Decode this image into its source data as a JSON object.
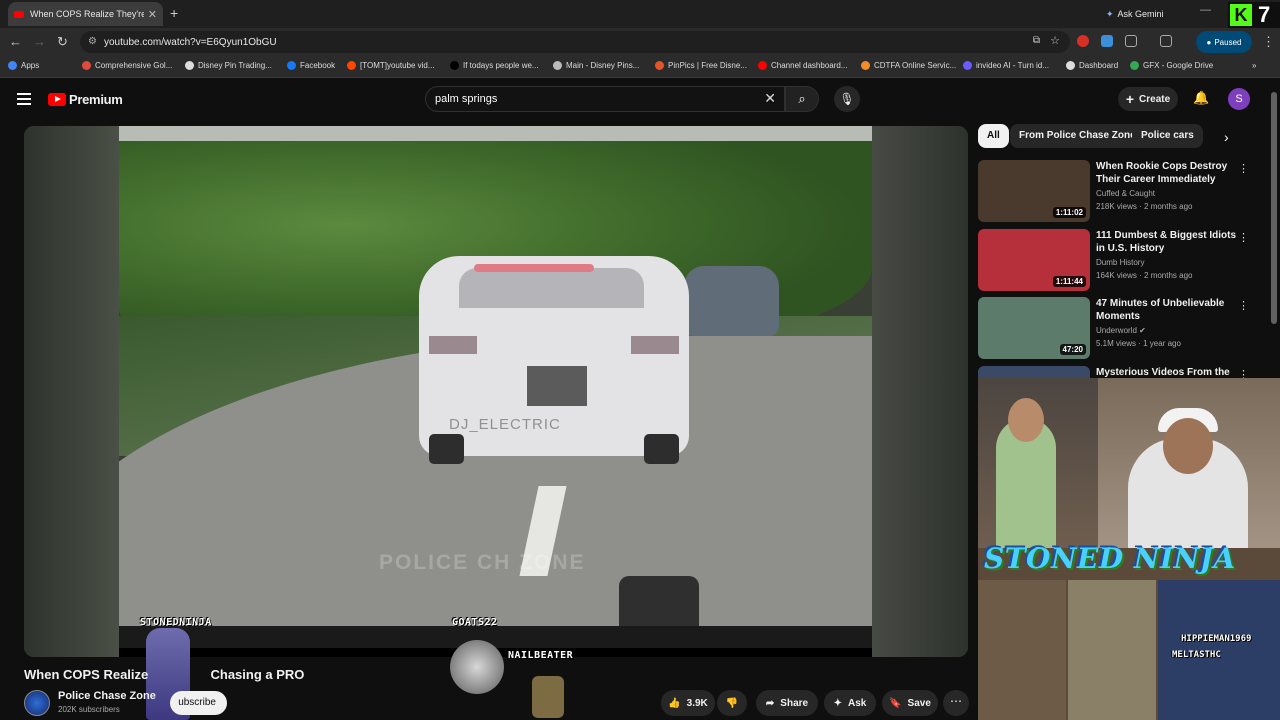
{
  "browser": {
    "tab_title": "When COPS Realize They're Ch",
    "new_tab": "+",
    "ask_gemini": "Ask Gemini",
    "kick_badge": "7",
    "url": "youtube.com/watch?v=E6Qyun1ObGU",
    "paused_label": "Paused",
    "bookmarks": [
      {
        "label": "Apps",
        "color": "#4285f4"
      },
      {
        "label": "Comprehensive Gol...",
        "color": "#e04a3a"
      },
      {
        "label": "Disney Pin Trading...",
        "color": "#dddddd"
      },
      {
        "label": "Facebook",
        "color": "#1877f2"
      },
      {
        "label": "[TOMT]youtube vid...",
        "color": "#ff4500"
      },
      {
        "label": "If todays people we...",
        "color": "#000000"
      },
      {
        "label": "Main - Disney Pins...",
        "color": "#bbbbbb"
      },
      {
        "label": "PinPics | Free Disne...",
        "color": "#e2542a"
      },
      {
        "label": "Channel dashboard...",
        "color": "#ff0000"
      },
      {
        "label": "CDTFA Online Servic...",
        "color": "#f28c28"
      },
      {
        "label": "invideo AI - Turn id...",
        "color": "#6a5cff"
      },
      {
        "label": "Dashboard",
        "color": "#dddddd"
      },
      {
        "label": "GFX - Google Drive",
        "color": "#34a853"
      }
    ]
  },
  "youtube": {
    "logo_text": "Premium",
    "search_value": "palm springs",
    "create_label": "Create",
    "avatar_letter": "S"
  },
  "video": {
    "title_left": "When COPS Realize",
    "title_right": "Chasing a PRO",
    "channel": "Police Chase Zone",
    "subscribers": "202K subscribers",
    "subscribe_label": "ubscribe",
    "likes": "3.9K",
    "share_label": "Share",
    "ask_label": "Ask",
    "save_label": "Save",
    "watermark": "POLICE CH      ZONE",
    "plate_text": "DJ_ELECTRIC"
  },
  "overlays": {
    "stoned_small": "STONEDNINJA",
    "goats": "GOATS22",
    "nailbeater": "NAILBEATER",
    "stoned_big": "STONED NINJA",
    "hippie": "HIPPIEMAN1969",
    "melt": "MELTASTHC"
  },
  "sidebar": {
    "chips": [
      "All",
      "From Police Chase Zone",
      "Police cars"
    ],
    "recs": [
      {
        "title": "When Rookie Cops Destroy Their Career Immediately",
        "channel": "Cuffed & Caught",
        "meta": "218K views · 2 months ago",
        "duration": "1:11:02",
        "thumb_color": "#4a3a2e"
      },
      {
        "title": "111 Dumbest & Biggest Idiots in U.S. History",
        "channel": "Dumb History",
        "meta": "164K views · 2 months ago",
        "duration": "1:11:44",
        "thumb_color": "#b5303a"
      },
      {
        "title": "47 Minutes of Unbelievable Moments",
        "channel": "Underworld",
        "meta": "5.1M views · 1 year ago",
        "duration": "47:20",
        "thumb_color": "#5c7b6a"
      },
      {
        "title": "Mysterious Videos From the",
        "channel": "",
        "meta": "",
        "duration": "",
        "thumb_color": "#3a4a66"
      }
    ]
  }
}
